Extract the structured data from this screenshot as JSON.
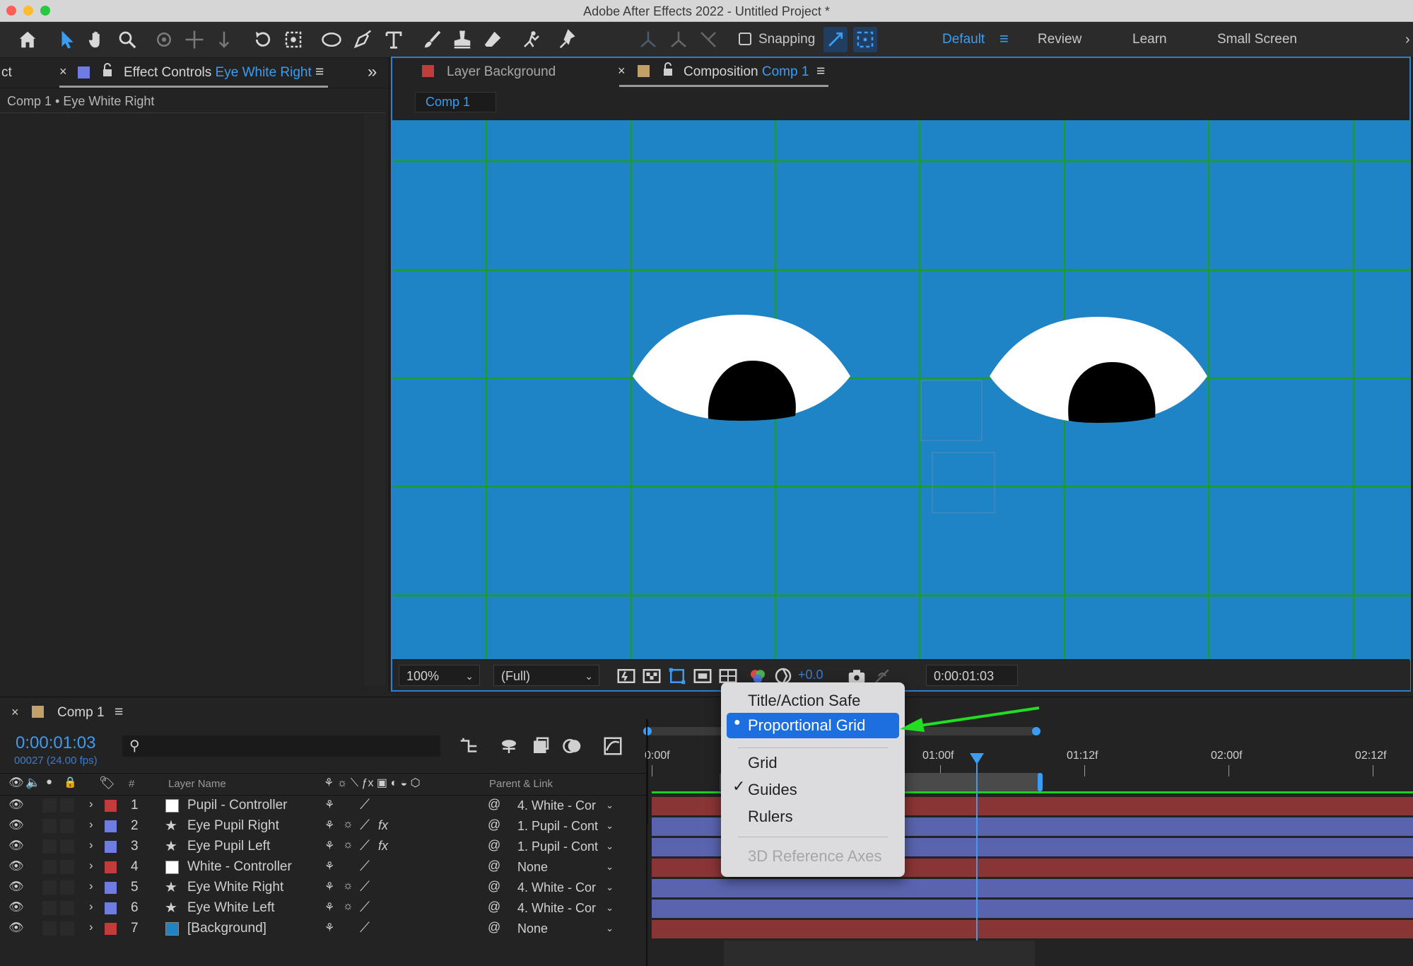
{
  "window": {
    "title": "Adobe After Effects 2022 - Untitled Project *"
  },
  "toolbar": {
    "snapping_label": "Snapping",
    "workspaces": [
      "Default",
      "Review",
      "Learn",
      "Small Screen"
    ],
    "active_workspace": "Default"
  },
  "left_panel": {
    "partial_tab": "ct",
    "tab_prefix": "Effect Controls",
    "tab_layer": "Eye White Right",
    "breadcrumb": "Comp 1 • Eye White Right"
  },
  "viewer_panel": {
    "layer_tab": "Layer Background",
    "comp_tab_prefix": "Composition",
    "comp_tab_name": "Comp 1",
    "comp_button": "Comp 1",
    "zoom": "100%",
    "resolution": "(Full)",
    "exposure": "+0.0",
    "timecode": "0:00:01:03"
  },
  "grid_menu": {
    "items": [
      {
        "label": "Title/Action Safe",
        "state": "normal"
      },
      {
        "label": "Proportional Grid",
        "state": "highlighted",
        "marker": "●"
      },
      {
        "label": "Grid",
        "state": "normal"
      },
      {
        "label": "Guides",
        "state": "checked",
        "marker": "✓"
      },
      {
        "label": "Rulers",
        "state": "normal"
      },
      {
        "label": "3D Reference Axes",
        "state": "disabled"
      }
    ]
  },
  "timeline": {
    "tab": "Comp 1",
    "timecode": "0:00:01:03",
    "frames": "00027 (24.00 fps)",
    "col_hash": "#",
    "col_layer_name": "Layer Name",
    "col_parent": "Parent & Link",
    "ruler_ticks": [
      "0:00f",
      "01:00f",
      "01:12f",
      "02:00f",
      "02:12f"
    ],
    "layers": [
      {
        "num": "1",
        "name": "Pupil - Controller",
        "parent": "4. White - Cor",
        "label_color": "#c33c3c",
        "kind": "null",
        "fx": ""
      },
      {
        "num": "2",
        "name": "Eye Pupil Right",
        "parent": "1. Pupil - Cont",
        "label_color": "#6f7de0",
        "kind": "shape",
        "fx": "fx"
      },
      {
        "num": "3",
        "name": "Eye Pupil Left",
        "parent": "1. Pupil - Cont",
        "label_color": "#6f7de0",
        "kind": "shape",
        "fx": "fx"
      },
      {
        "num": "4",
        "name": "White - Controller",
        "parent": "None",
        "label_color": "#c33c3c",
        "kind": "null",
        "fx": ""
      },
      {
        "num": "5",
        "name": "Eye White Right",
        "parent": "4. White - Cor",
        "label_color": "#6f7de0",
        "kind": "shape",
        "fx": ""
      },
      {
        "num": "6",
        "name": "Eye White Left",
        "parent": "4. White - Cor",
        "label_color": "#6f7de0",
        "kind": "shape",
        "fx": ""
      },
      {
        "num": "7",
        "name": "[Background]",
        "parent": "None",
        "label_color": "#c33c3c",
        "kind": "solid",
        "fx": ""
      }
    ]
  },
  "colors": {
    "accent": "#3b9cf2",
    "comp_background": "#1f84c6",
    "grid_lines": "#1c9a3a",
    "menu_highlight": "#1d6fe0",
    "annotation_arrow": "#22dd22",
    "red_label": "#c33c3c",
    "blue_label": "#6f7de0"
  }
}
